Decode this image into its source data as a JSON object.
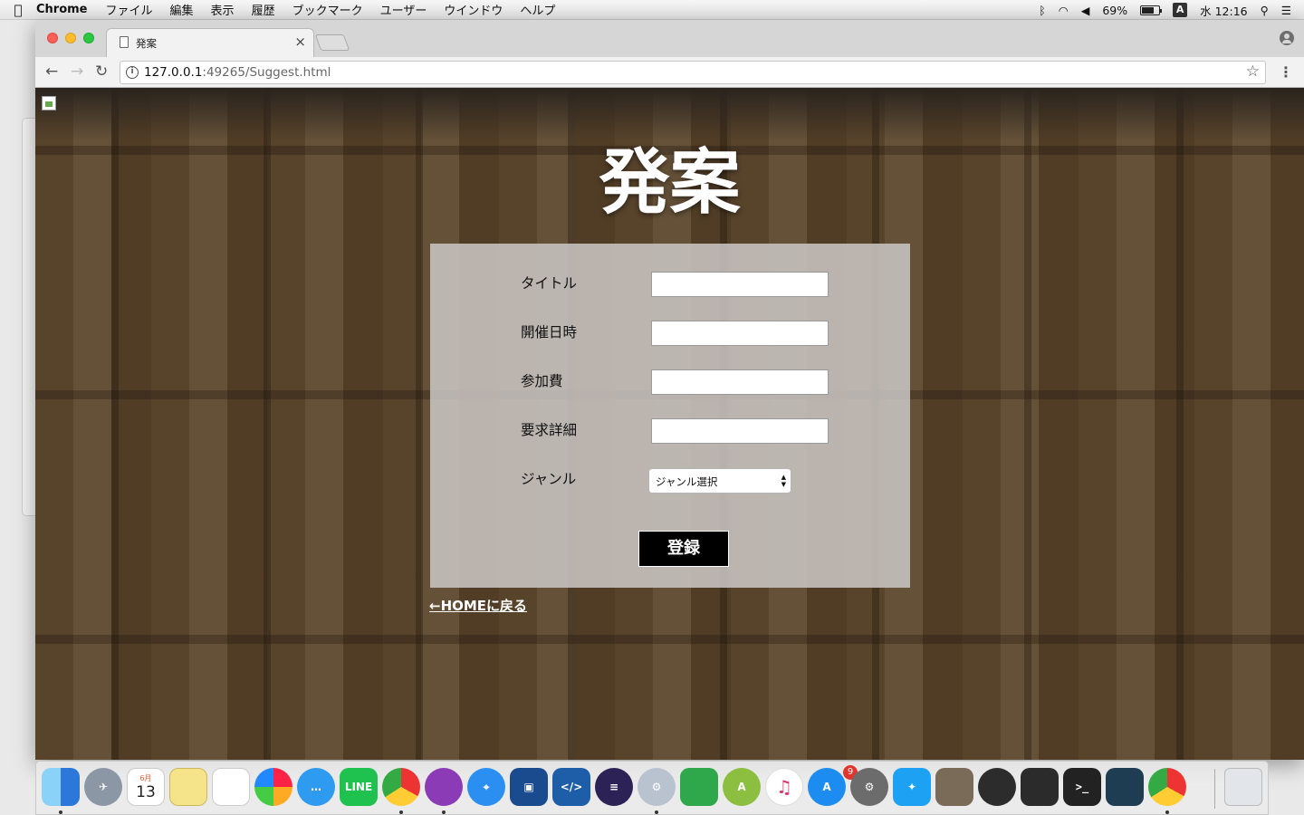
{
  "menubar": {
    "app_name": "Chrome",
    "menus": [
      "ファイル",
      "編集",
      "表示",
      "履歴",
      "ブックマーク",
      "ユーザー",
      "ウインドウ",
      "ヘルプ"
    ],
    "battery_percent": "69%",
    "battery_level": 0.69,
    "input_source": "A",
    "clock": "水 12:16"
  },
  "browser": {
    "tab_title": "発案",
    "url_host": "127.0.0.1",
    "url_path": ":49265/Suggest.html"
  },
  "page": {
    "title": "発案",
    "form": {
      "fields": [
        {
          "label": "タイトル",
          "value": ""
        },
        {
          "label": "開催日時",
          "value": ""
        },
        {
          "label": "参加費",
          "value": ""
        },
        {
          "label": "要求詳細",
          "value": ""
        }
      ],
      "genre_label": "ジャンル",
      "genre_selected": "ジャンル選択",
      "submit_label": "登録"
    },
    "home_link": "←HOMEに戻る"
  },
  "dock": {
    "date_month": "6月",
    "date_day": "13",
    "app_store_badge": "9",
    "line_label": "LINE"
  }
}
